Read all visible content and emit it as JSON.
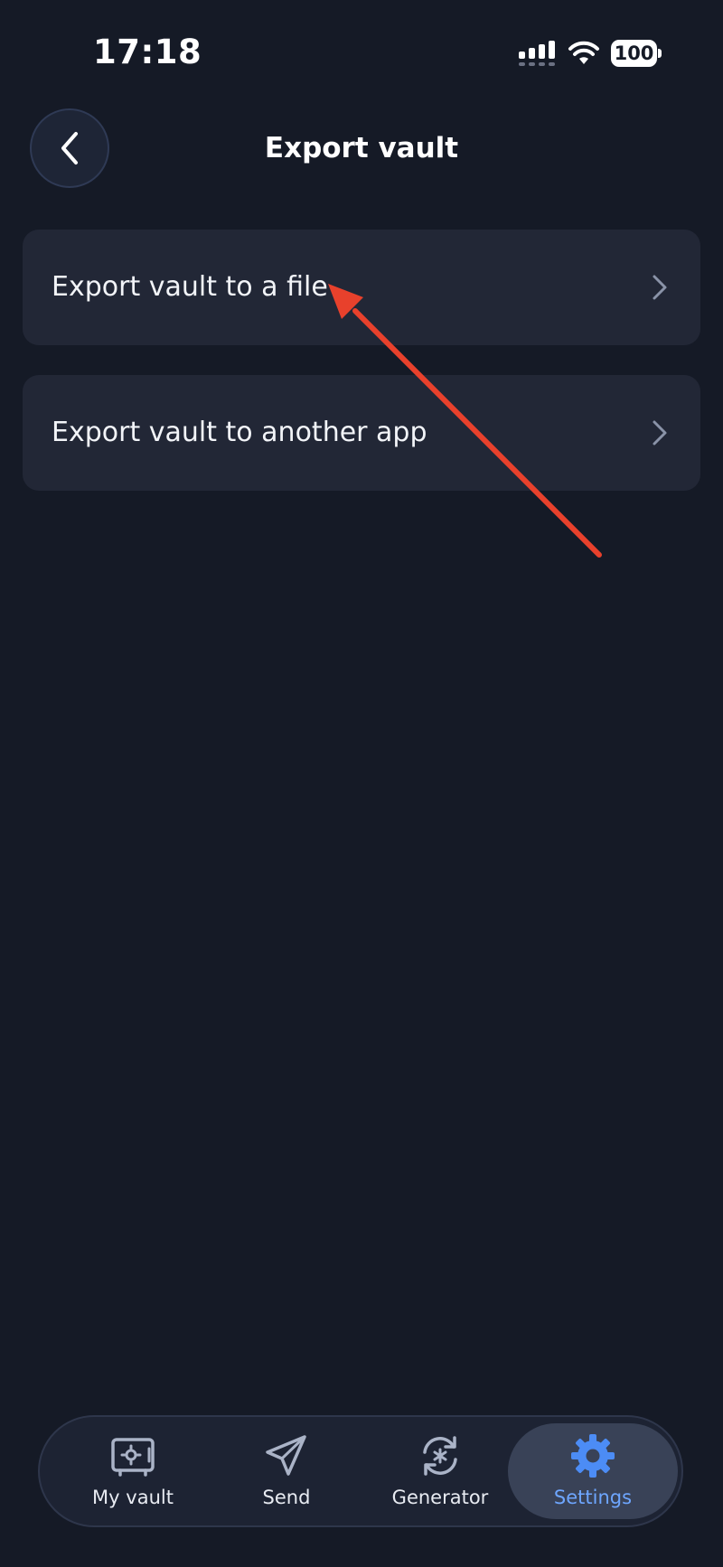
{
  "status_bar": {
    "time": "17:18",
    "battery": "100"
  },
  "header": {
    "title": "Export vault"
  },
  "options": [
    {
      "label": "Export vault to a file"
    },
    {
      "label": "Export vault to another app"
    }
  ],
  "tab_bar": {
    "tabs": [
      {
        "label": "My vault",
        "icon": "vault-icon",
        "active": false
      },
      {
        "label": "Send",
        "icon": "send-icon",
        "active": false
      },
      {
        "label": "Generator",
        "icon": "generator-icon",
        "active": false
      },
      {
        "label": "Settings",
        "icon": "gear-icon",
        "active": true
      }
    ]
  },
  "colors": {
    "background": "#151a26",
    "row": "#222736",
    "accent": "#6ea6ff",
    "annotation": "#e8412c"
  }
}
